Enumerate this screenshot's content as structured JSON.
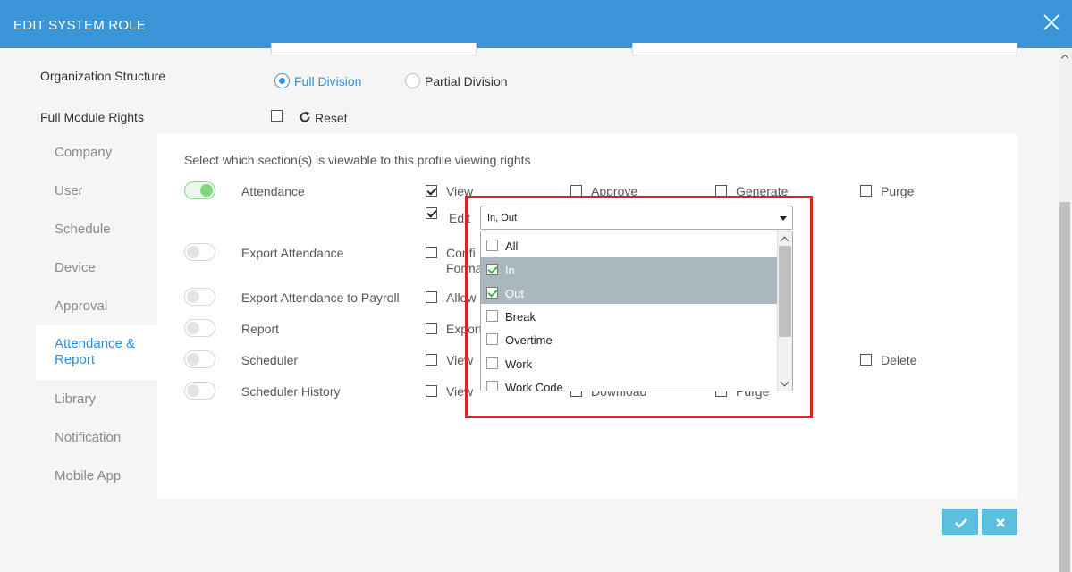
{
  "dialog": {
    "title": "EDIT SYSTEM ROLE"
  },
  "form": {
    "org_structure_label": "Organization Structure",
    "full_division_label": "Full Division",
    "partial_division_label": "Partial Division",
    "full_module_rights_label": "Full Module Rights",
    "reset_label": "Reset"
  },
  "sidebar": {
    "items": [
      {
        "label": "Company"
      },
      {
        "label": "User"
      },
      {
        "label": "Schedule"
      },
      {
        "label": "Device"
      },
      {
        "label": "Approval"
      },
      {
        "label": "Attendance & Report"
      },
      {
        "label": "Library"
      },
      {
        "label": "Notification"
      },
      {
        "label": "Mobile App"
      }
    ]
  },
  "panel": {
    "instruction": "Select which section(s) is viewable to this profile viewing rights",
    "rows": [
      {
        "label": "Attendance",
        "toggle_on": true,
        "opts": [
          "View",
          "Approve",
          "Generate",
          "Purge"
        ],
        "edit_label": "Edit"
      },
      {
        "label": "Export Attendance",
        "toggle_on": false,
        "opts": [
          "Confi",
          "Forma"
        ]
      },
      {
        "label": "Export Attendance to Payroll",
        "toggle_on": false,
        "opts": [
          "Allow"
        ]
      },
      {
        "label": "Report",
        "toggle_on": false,
        "opts": [
          "Export"
        ]
      },
      {
        "label": "Scheduler",
        "toggle_on": false,
        "opts": [
          "View",
          "Delete"
        ]
      },
      {
        "label": "Scheduler History",
        "toggle_on": false,
        "opts": [
          "View",
          "Download",
          "Purge"
        ]
      }
    ]
  },
  "edit_select": {
    "value": "In, Out",
    "options": [
      {
        "label": "All",
        "selected": false
      },
      {
        "label": "In",
        "selected": true
      },
      {
        "label": "Out",
        "selected": true
      },
      {
        "label": "Break",
        "selected": false
      },
      {
        "label": "Overtime",
        "selected": false
      },
      {
        "label": "Work",
        "selected": false
      },
      {
        "label": "Work Code",
        "selected": false
      }
    ]
  },
  "colors": {
    "header": "#3a96d8",
    "accent": "#2e8fd9",
    "highlight": "#e21f26",
    "button": "#5bc0de",
    "selected_option": "#aab7bf"
  },
  "icons": {
    "close": "close-icon",
    "reset": "refresh-icon",
    "confirm": "check-icon",
    "cancel": "x-icon"
  }
}
